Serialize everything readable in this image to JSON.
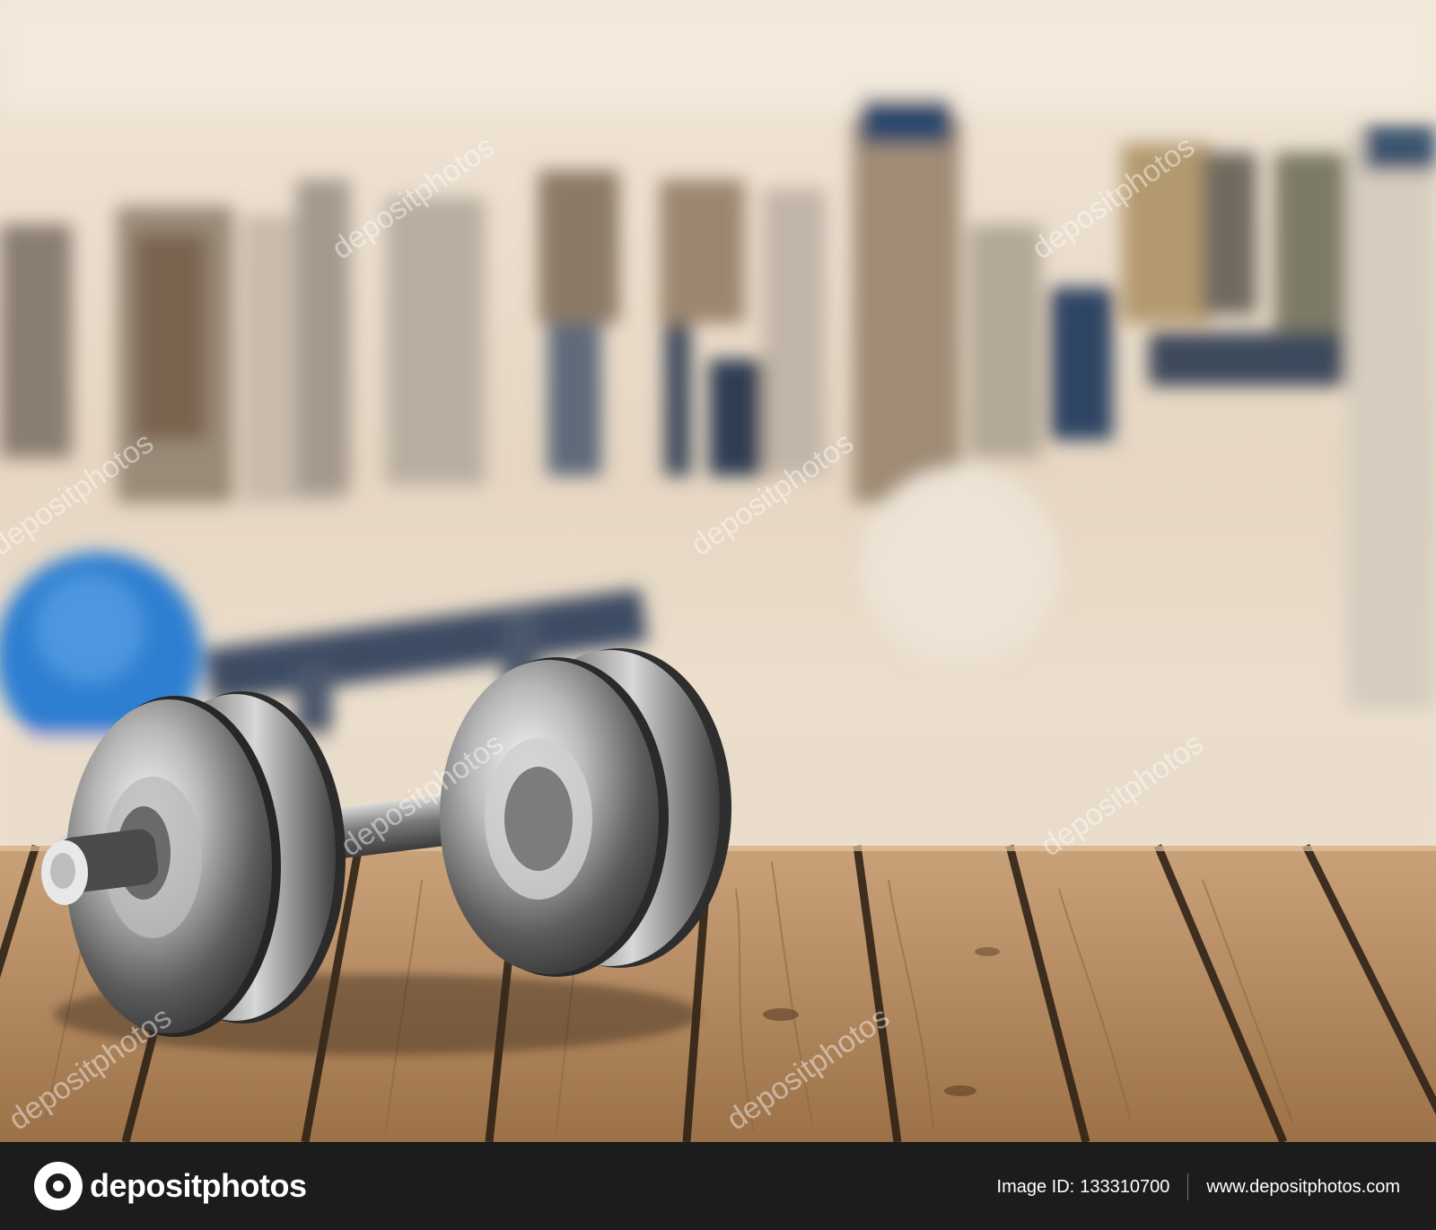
{
  "watermark": {
    "text": "depositphotos"
  },
  "footer": {
    "logo_text": "depositphotos",
    "image_id_label": "Image ID:",
    "image_id_value": "133310700",
    "website": "www.depositphotos.com"
  },
  "colors": {
    "footer_background": "#1c1c1c",
    "wood": "#b58a5c",
    "gym_background": "#eadccb"
  },
  "icons": [
    "depositphotos-logo-icon"
  ]
}
